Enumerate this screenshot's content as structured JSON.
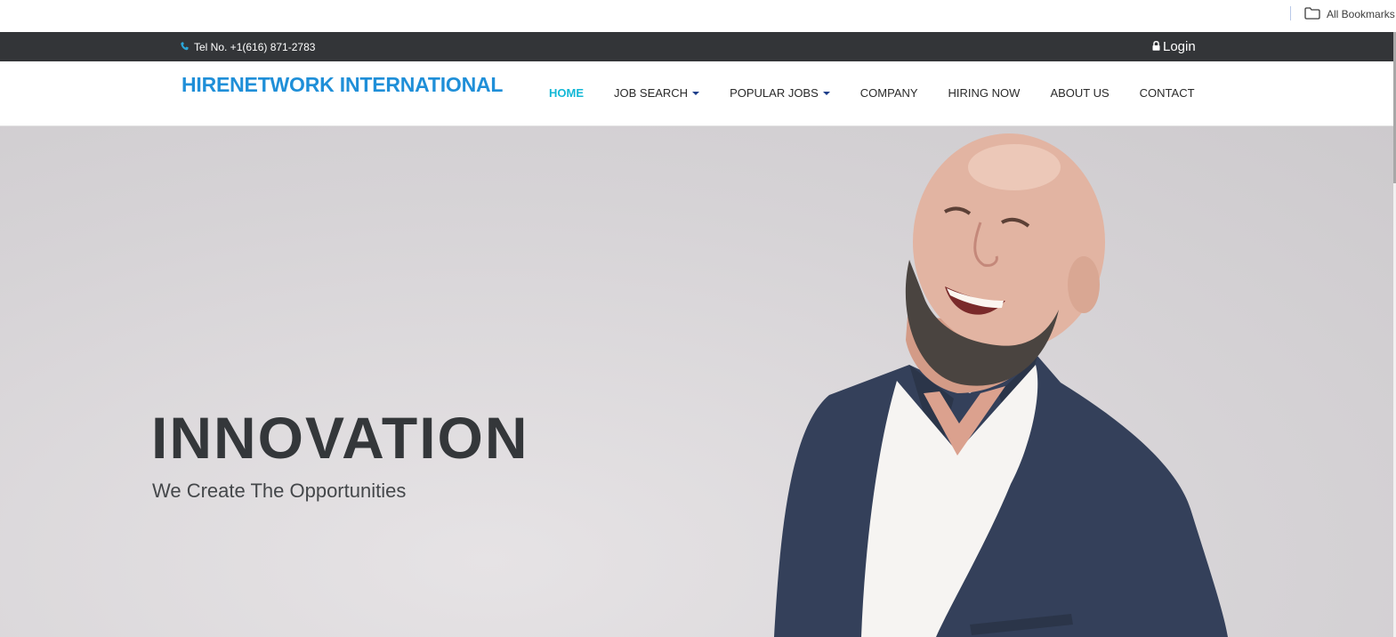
{
  "browser": {
    "bookmarks_label": "All Bookmarks"
  },
  "topbar": {
    "phone": "Tel No. +1(616) 871-2783",
    "login": "Login"
  },
  "header": {
    "brand": "HIRENETWORK INTERNATIONAL",
    "nav": [
      {
        "label": "HOME",
        "active": true
      },
      {
        "label": "JOB SEARCH",
        "dropdown": true
      },
      {
        "label": "POPULAR JOBS",
        "dropdown": true
      },
      {
        "label": "COMPANY"
      },
      {
        "label": "HIRING NOW"
      },
      {
        "label": "ABOUT US"
      },
      {
        "label": "CONTACT"
      }
    ]
  },
  "hero": {
    "title": "INNOVATION",
    "subtitle": "We Create The Opportunities"
  },
  "colors": {
    "brand": "#1f8fd8",
    "active_nav": "#14b8d6",
    "topbar_bg": "#333538"
  }
}
